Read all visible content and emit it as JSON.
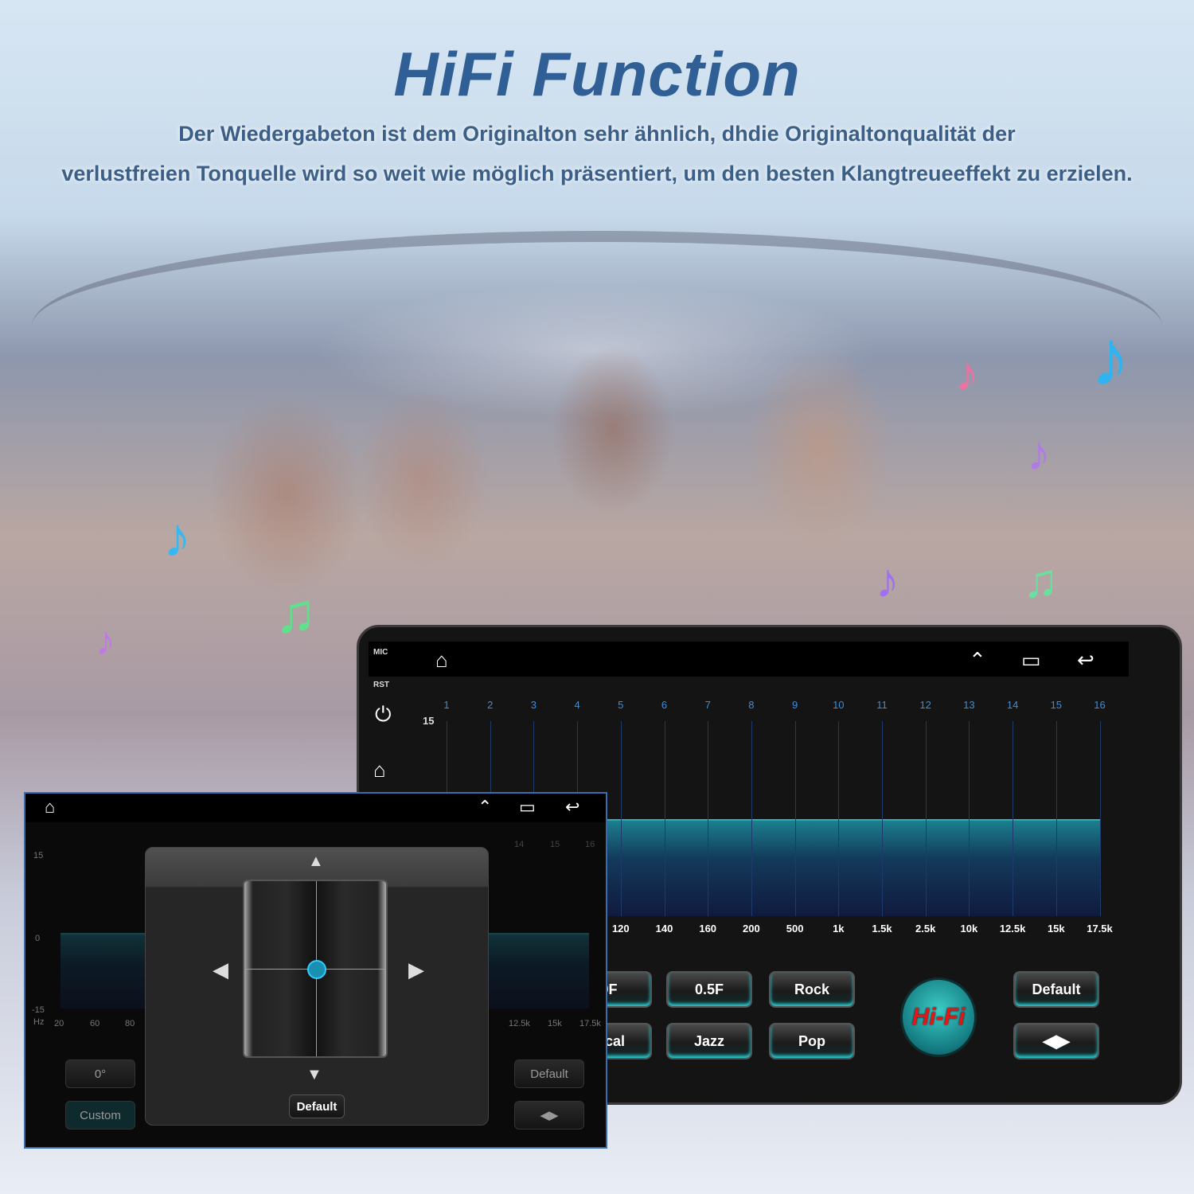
{
  "title": "HiFi Function",
  "subtitle_lines": [
    "Der Wiedergabeton ist dem Originalton sehr ähnlich, dhdie Originaltonqualität der",
    "verlustfreien Tonquelle wird so weit wie möglich präsentiert, um den besten Klangtreueeffekt zu erzielen."
  ],
  "main_screen": {
    "side_labels": {
      "mic": "MIC",
      "rst": "RST"
    },
    "icons": [
      "home-icon",
      "double-chevron-up-icon",
      "recent-apps-icon",
      "back-icon",
      "power-icon",
      "home-outline-icon"
    ],
    "y_max_label": "15",
    "band_numbers": [
      "1",
      "2",
      "3",
      "4",
      "5",
      "6",
      "7",
      "8",
      "9",
      "10",
      "11",
      "12",
      "13",
      "14",
      "15",
      "16"
    ],
    "frequencies": [
      "120",
      "140",
      "160",
      "200",
      "500",
      "1k",
      "1.5k",
      "2.5k",
      "10k",
      "12.5k",
      "15k",
      "17.5k"
    ],
    "band_gain_db": 0,
    "presets": {
      "row1": [
        "0F",
        "0.5F",
        "Rock"
      ],
      "row2": [
        "sical",
        "Jazz",
        "Pop"
      ]
    },
    "hifi_label": "Hi-Fi",
    "default_label": "Default",
    "accent": "#2bb0b8"
  },
  "small_screen": {
    "y_labels": [
      "15",
      "0",
      "-15"
    ],
    "unit": "Hz",
    "freq_left": [
      "20",
      "60",
      "80"
    ],
    "freq_right": [
      "12.5k",
      "15k",
      "17.5k"
    ],
    "band_numbers_right": [
      "14",
      "15",
      "16"
    ],
    "angle_button": "0°",
    "custom_button": "Custom",
    "default_button": "Default",
    "popup_default": "Default"
  }
}
